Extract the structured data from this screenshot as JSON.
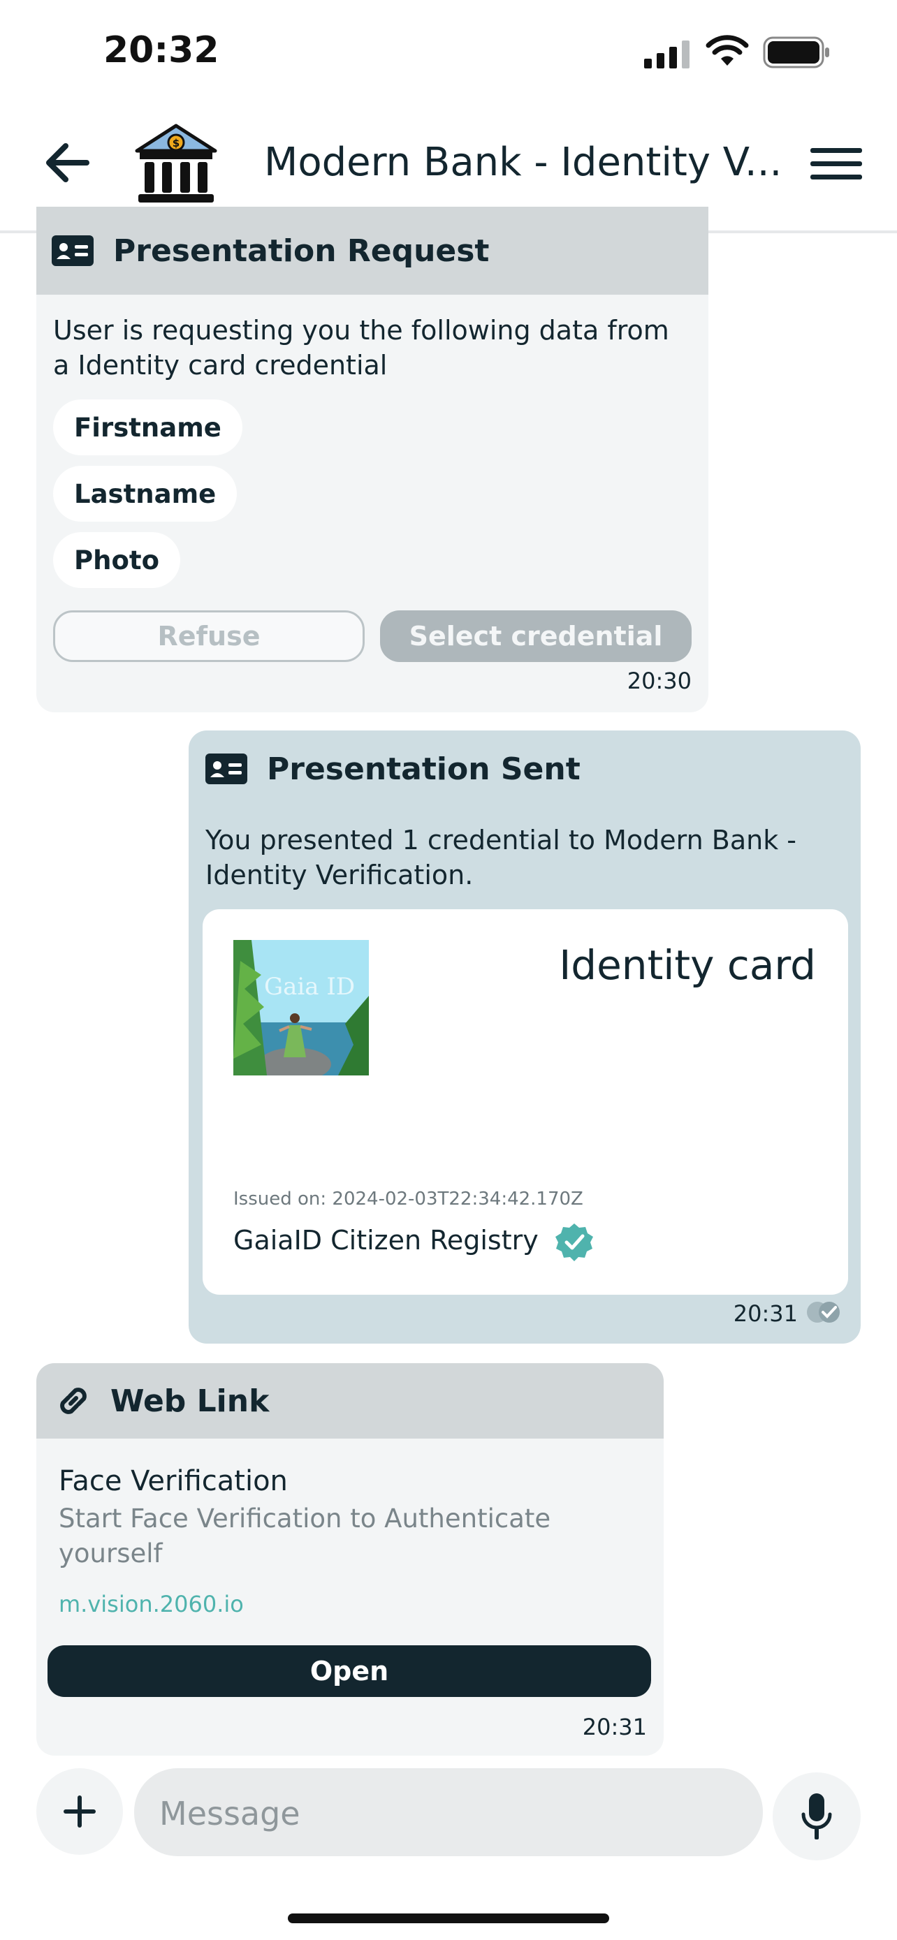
{
  "status_bar": {
    "time": "20:32"
  },
  "header": {
    "title": "Modern Bank - Identity V..."
  },
  "presentation_request": {
    "title": "Presentation Request",
    "description": "User is requesting you the following data from a Identity card credential",
    "fields": [
      "Firstname",
      "Lastname",
      "Photo"
    ],
    "refuse_label": "Refuse",
    "select_label": "Select credential",
    "time": "20:30"
  },
  "presentation_sent": {
    "title": "Presentation Sent",
    "description": "You presented 1 credential to Modern Bank - Identity Verification.",
    "card": {
      "title": "Identity card",
      "image_text": "Gaia ID",
      "issued_on": "Issued on: 2024-02-03T22:34:42.170Z",
      "issuer": "GaiaID Citizen Registry"
    },
    "time": "20:31"
  },
  "web_link": {
    "title": "Web Link",
    "link_title": "Face Verification",
    "link_description": "Start Face Verification to Authenticate yourself",
    "url": "m.vision.2060.io",
    "open_label": "Open",
    "time": "20:31"
  },
  "composer": {
    "placeholder": "Message"
  },
  "colors": {
    "dark": "#13262f",
    "teal": "#4fb3ad",
    "incoming": "#f3f5f6",
    "outgoing": "#cedde2"
  }
}
